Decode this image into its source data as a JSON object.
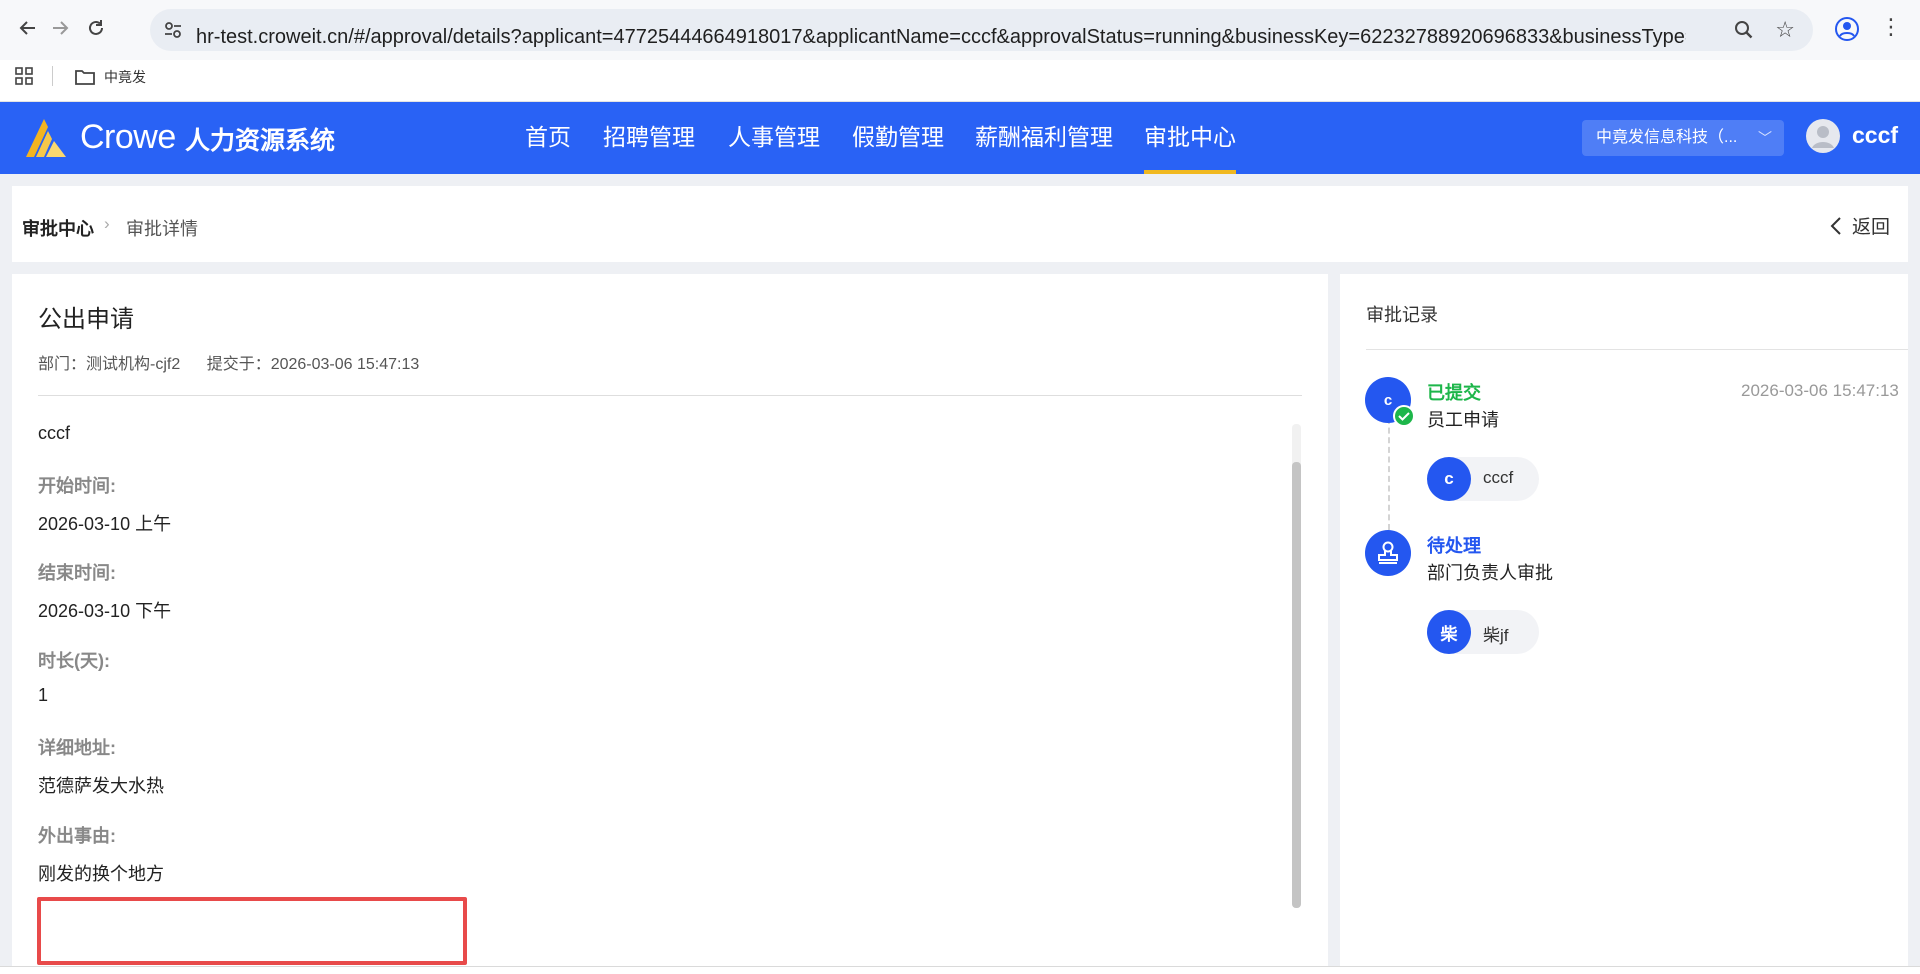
{
  "browser": {
    "url": "hr-test.croweit.cn/#/approval/details?applicant=47725444664918017&applicantName=cccf&approvalStatus=running&businessKey=62232788920696833&businessType=公出&dat...",
    "bookmark_label": "中竟发"
  },
  "header": {
    "logo_text": "Crowe",
    "system_name": "人力资源系统",
    "nav": [
      "首页",
      "招聘管理",
      "人事管理",
      "假勤管理",
      "薪酬福利管理",
      "审批中心"
    ],
    "active_nav": "审批中心",
    "company": "中竟发信息科技（...",
    "user": "cccf",
    "brand_color": "#2962f5",
    "active_underline_color": "#f0b820"
  },
  "breadcrumb": {
    "root": "审批中心",
    "current": "审批详情",
    "back_label": "返回"
  },
  "form": {
    "title": "公出申请",
    "department": "部门：测试机构-cjf2",
    "submitted": "提交于：2026-03-06 15:47:13",
    "applicant": "cccf",
    "fields": [
      {
        "label": "开始时间:",
        "value": "2026-03-10 上午"
      },
      {
        "label": "结束时间:",
        "value": "2026-03-10 下午"
      },
      {
        "label": "时长(天):",
        "value": "1"
      },
      {
        "label": "详细地址:",
        "value": "范德萨发大水热"
      },
      {
        "label": "外出事由:",
        "value": "刚发的换个地方"
      }
    ]
  },
  "records": {
    "title": "审批记录",
    "steps": [
      {
        "avatar": "c",
        "status": "已提交",
        "status_color": "#1db64a",
        "name": "员工申请",
        "time": "2026-03-06 15:47:13",
        "person": {
          "avatar": "c",
          "name": "cccf"
        }
      },
      {
        "status": "待处理",
        "status_color": "#2457f0",
        "name": "部门负责人审批",
        "person": {
          "avatar": "柴",
          "name": "柴jf"
        }
      }
    ]
  }
}
